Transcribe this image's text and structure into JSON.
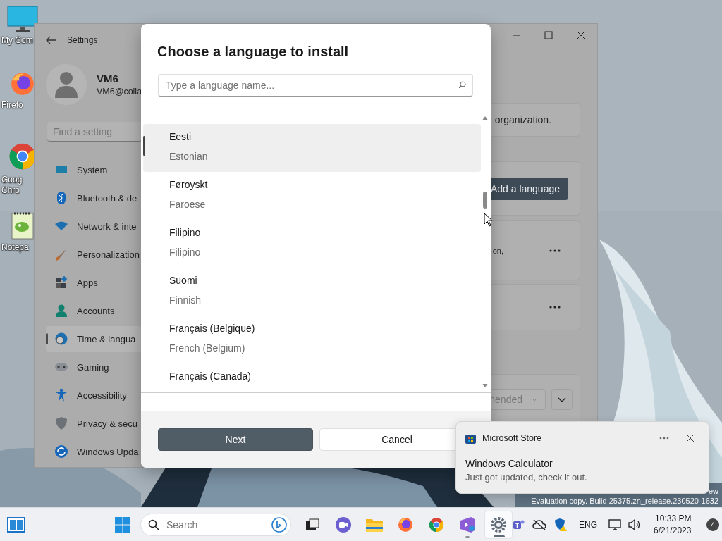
{
  "desktop": {
    "icons": [
      {
        "label": "My Com",
        "kind": "computer"
      },
      {
        "label": "Firefo",
        "kind": "firefox"
      },
      {
        "label": "Goog\nChro",
        "kind": "chrome"
      },
      {
        "label": "Notepa",
        "kind": "notepad"
      }
    ],
    "build_text": [
      "ew",
      "Evaluation copy. Build 25375.zn_release.230520-1632"
    ]
  },
  "settings_window": {
    "title": "Settings",
    "user": {
      "name": "VM6",
      "email": "VM6@colla"
    },
    "search": {
      "placeholder": "Find a setting"
    },
    "nav": [
      {
        "label": "System",
        "selected": false
      },
      {
        "label": "Bluetooth & de",
        "selected": false
      },
      {
        "label": "Network & inte",
        "selected": false
      },
      {
        "label": "Personalization",
        "selected": false
      },
      {
        "label": "Apps",
        "selected": false
      },
      {
        "label": "Accounts",
        "selected": false
      },
      {
        "label": "Time & langua",
        "selected": true
      },
      {
        "label": "Gaming",
        "selected": false
      },
      {
        "label": "Accessibility",
        "selected": false
      },
      {
        "label": "Privacy & secu",
        "selected": false
      },
      {
        "label": "Windows Upda",
        "selected": false
      }
    ],
    "notice": "organization.",
    "add_button": "Add a language",
    "cards": [
      {
        "detail": "on,",
        "more_button": true
      },
      {
        "more_button": true
      }
    ],
    "dropdown": {
      "value": "nended"
    }
  },
  "dialog": {
    "title": "Choose a language to install",
    "search": {
      "placeholder": "Type a language name..."
    },
    "languages": [
      {
        "native": "Eesti",
        "english": "Estonian",
        "selected": true
      },
      {
        "native": "Føroyskt",
        "english": "Faroese",
        "selected": false
      },
      {
        "native": "Filipino",
        "english": "Filipino",
        "selected": false
      },
      {
        "native": "Suomi",
        "english": "Finnish",
        "selected": false
      },
      {
        "native": "Français (Belgique)",
        "english": "French (Belgium)",
        "selected": false
      },
      {
        "native": "Français (Canada)",
        "selected": false
      }
    ],
    "buttons": [
      {
        "label": "Next",
        "kind": "primary"
      },
      {
        "label": "Cancel",
        "kind": "secondary"
      }
    ]
  },
  "toast": {
    "app": "Microsoft Store",
    "title": "Windows Calculator",
    "body": "Just got updated, check it out."
  },
  "taskbar": {
    "search": {
      "placeholder": "Search"
    },
    "apps": [
      {
        "kind": "task-view",
        "running": false,
        "active": false
      },
      {
        "kind": "chat",
        "running": false,
        "active": false
      },
      {
        "kind": "folder",
        "running": false,
        "active": false
      },
      {
        "kind": "firefox",
        "running": false,
        "active": false
      },
      {
        "kind": "chrome",
        "running": false,
        "active": false
      },
      {
        "kind": "studio",
        "running": true,
        "active": false
      },
      {
        "kind": "settings",
        "running": true,
        "active": true
      }
    ],
    "language": "ENG",
    "time": "10:33 PM",
    "date": "6/21/2023",
    "notification_count": "4"
  }
}
